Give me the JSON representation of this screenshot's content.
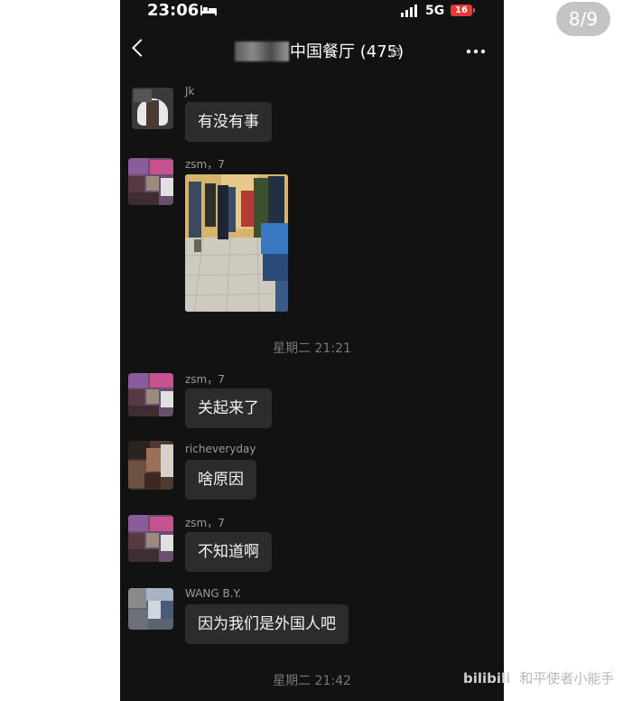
{
  "viewer": {
    "counter": "8/9"
  },
  "status_bar": {
    "time": "23:06",
    "network": "5G",
    "battery": "16"
  },
  "header": {
    "title": "中国餐厅",
    "member_count": "(475)",
    "back_icon": "chevron-left-icon",
    "mute_icon": "bell-off-icon",
    "more_icon": "more-dots-icon"
  },
  "messages": [
    {
      "sender": "Jk",
      "text": "有没有事"
    },
    {
      "sender": "zsm，7",
      "text": ""
    },
    {
      "sender": "zsm，7",
      "text": "关起来了"
    },
    {
      "sender": "richeveryday",
      "text": "啥原因"
    },
    {
      "sender": "zsm，7",
      "text": "不知道啊"
    },
    {
      "sender": "WANG B.Y.",
      "text": "因为我们是外国人吧"
    }
  ],
  "timestamps": [
    "星期二 21:21",
    "星期二 21:42"
  ],
  "watermark": {
    "logo": "bilibili",
    "text": "和平使者小能手"
  }
}
